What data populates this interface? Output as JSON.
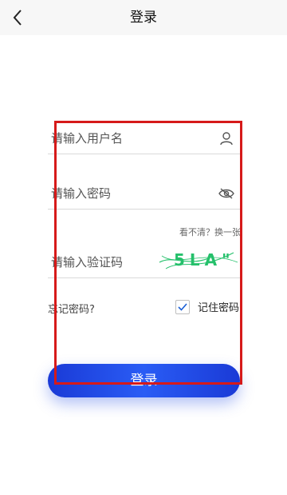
{
  "header": {
    "title": "登录",
    "back_icon": "chevron-left-icon"
  },
  "form": {
    "username_placeholder": "请输入用户名",
    "password_placeholder": "请输入密码",
    "captcha_placeholder": "请输入验证码",
    "captcha_hint": "看不清？换一张",
    "captcha_text": "5LA\"",
    "forgot_label": "忘记密码?",
    "remember_label": "记住密码",
    "remember_checked": true,
    "submit_label": "登录"
  },
  "icons": {
    "username": "user-icon",
    "password": "eye-hidden-icon",
    "checkbox": "checkmark-icon"
  },
  "colors": {
    "accent": "#1a3ad6",
    "highlight": "#d61a1a",
    "captcha_text": "#25c06b"
  }
}
